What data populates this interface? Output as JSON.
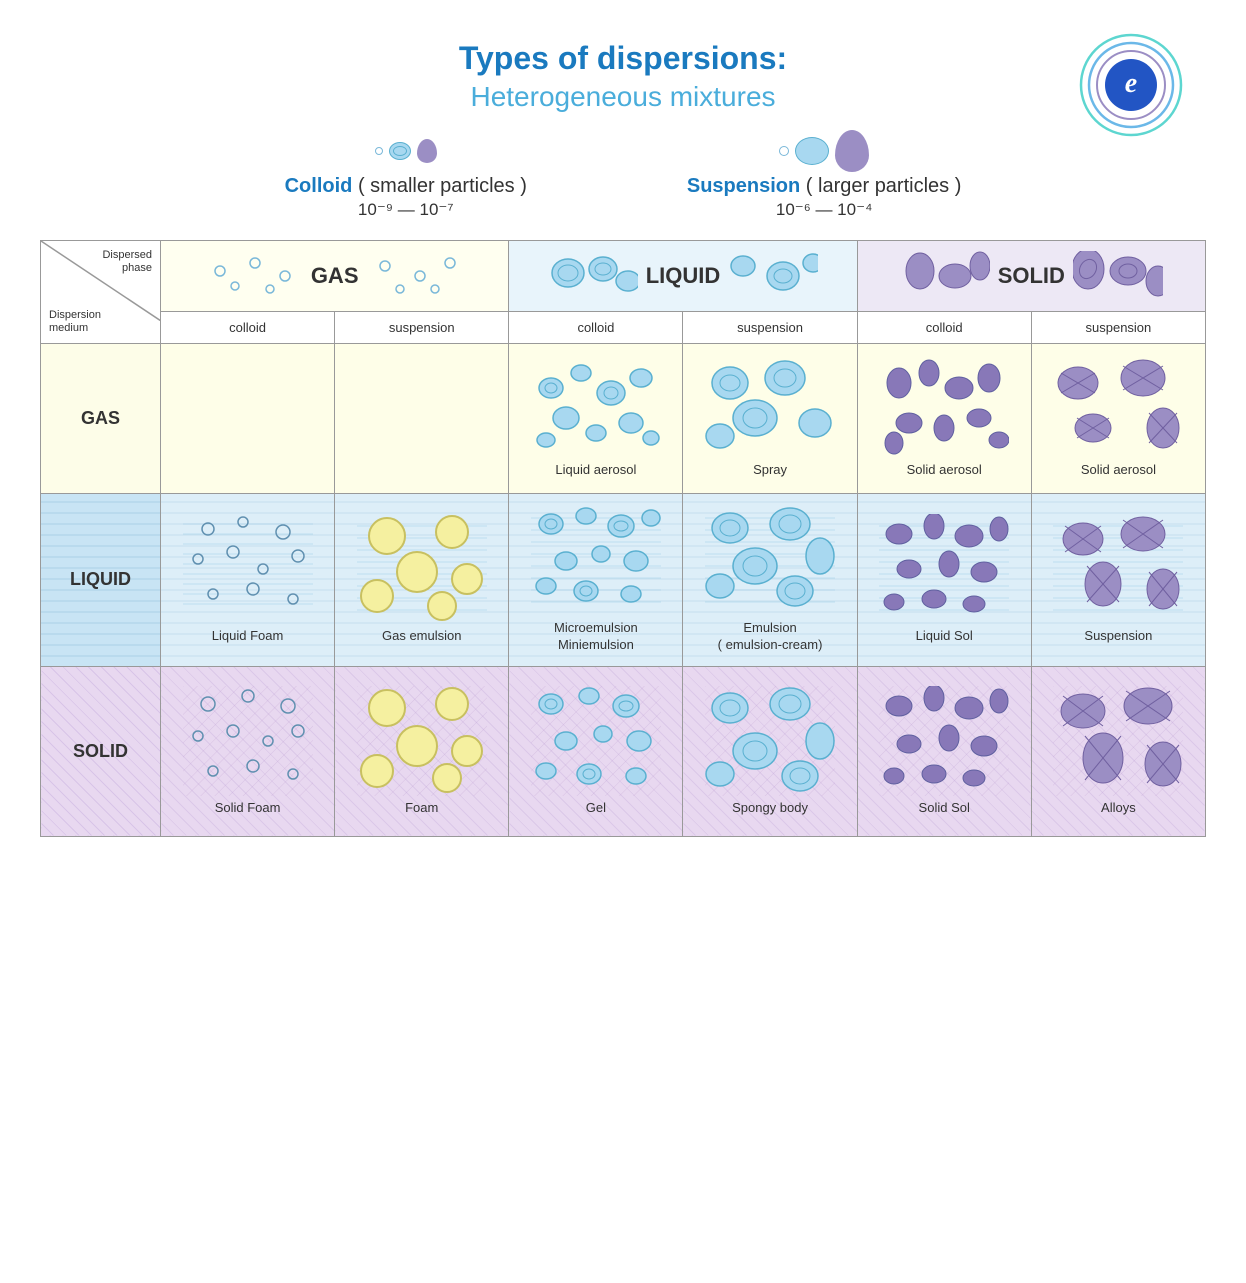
{
  "title": "Types of dispersions:",
  "subtitle": "Heterogeneous mixtures",
  "colloid": {
    "label": "Colloid",
    "suffix": "( smaller particles )",
    "range": "10⁻⁹ — 10⁻⁷"
  },
  "suspension": {
    "label": "Suspension",
    "suffix": "( larger particles )",
    "range": "10⁻⁶ — 10⁻⁴"
  },
  "table": {
    "dispersed_phase": "Dispersed phase",
    "dispersion_medium": "Dispersion medium",
    "col_headers": [
      "GAS",
      "GAS",
      "LIQUID",
      "LIQUID",
      "SOLID",
      "SOLID"
    ],
    "col_sub": [
      "colloid",
      "suspension",
      "colloid",
      "suspension",
      "colloid",
      "suspension"
    ],
    "rows": [
      {
        "label": "GAS",
        "cells": [
          {
            "name": "",
            "type": "empty"
          },
          {
            "name": "",
            "type": "empty"
          },
          {
            "name": "Liquid aerosol",
            "type": "liquid-in-gas"
          },
          {
            "name": "Spray",
            "type": "liquid-in-gas-large"
          },
          {
            "name": "Solid aerosol",
            "type": "solid-in-gas"
          },
          {
            "name": "Solid aerosol",
            "type": "solid-in-gas-large"
          }
        ]
      },
      {
        "label": "LIQUID",
        "cells": [
          {
            "name": "Liquid Foam",
            "type": "gas-in-liquid-small"
          },
          {
            "name": "Gas emulsion",
            "type": "gas-in-liquid-large"
          },
          {
            "name": "Microemulsion\nMiniemulsion",
            "type": "liquid-in-liquid-small"
          },
          {
            "name": "Emulsion\n( emulsion-cream)",
            "type": "liquid-in-liquid-large"
          },
          {
            "name": "Liquid Sol",
            "type": "solid-in-liquid-small"
          },
          {
            "name": "Suspension",
            "type": "solid-in-liquid-large"
          }
        ]
      },
      {
        "label": "SOLID",
        "cells": [
          {
            "name": "Solid Foam",
            "type": "gas-in-solid-small"
          },
          {
            "name": "Foam",
            "type": "gas-in-solid-large"
          },
          {
            "name": "Gel",
            "type": "liquid-in-solid-small"
          },
          {
            "name": "Spongy body",
            "type": "liquid-in-solid-large"
          },
          {
            "name": "Solid Sol",
            "type": "solid-in-solid-small"
          },
          {
            "name": "Alloys",
            "type": "solid-in-solid-large"
          }
        ]
      }
    ]
  }
}
